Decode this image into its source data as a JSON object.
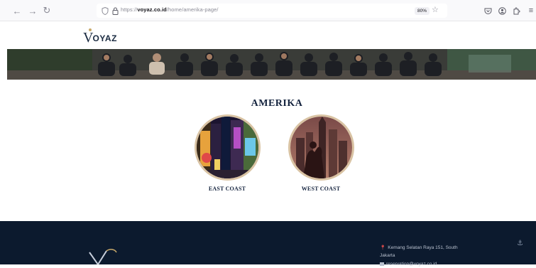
{
  "browser": {
    "url_scheme": "https://",
    "url_host": "voyaz.co.id",
    "url_path": "/home/amerika-page/",
    "zoom": "80%",
    "back_icon": "arrow-left-icon",
    "forward_icon": "arrow-right-icon",
    "reload_icon": "reload-icon"
  },
  "header": {
    "logo_initial": "V",
    "logo_rest": "OYAZ"
  },
  "main": {
    "title": "AMERIKA",
    "regions": [
      {
        "label": "EAST COAST"
      },
      {
        "label": "WEST COAST"
      }
    ]
  },
  "footer": {
    "address_line1": "Kemang Selatan Raya 151, South",
    "address_line2": "Jakarta",
    "email": "reservation@voyaz.co.id"
  },
  "colors": {
    "brand_navy": "#14233e",
    "footer_bg": "#0c1a2e",
    "accent_gold": "#c8a96a",
    "circle_border": "#d9c3a3"
  }
}
